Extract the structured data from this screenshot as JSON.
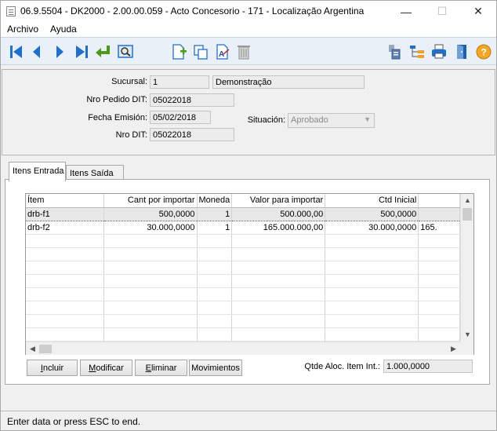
{
  "window": {
    "title": "06.9.5504 - DK2000 - 2.00.00.059 - Acto Concesorio - 171 - Localização Argentina",
    "minimize_glyph": "—",
    "maximize_glyph": "☐",
    "close_glyph": "✕"
  },
  "menu": {
    "items": [
      "Archivo",
      "Ayuda"
    ]
  },
  "toolbar": {
    "left_icons": [
      "first-record-icon",
      "prev-record-icon",
      "next-record-icon",
      "last-record-icon",
      "enter-icon",
      "search-icon"
    ],
    "mid_icons": [
      "new-document-icon",
      "copy-icon",
      "spell-check-icon",
      "trash-icon"
    ],
    "right_icons": [
      "report-icon",
      "hierarchy-icon",
      "printer-icon",
      "exit-icon",
      "help-icon"
    ],
    "help_glyph": "?"
  },
  "header": {
    "sucursal_label": "Sucursal:",
    "sucursal_code": "1",
    "sucursal_name": "Demonstração",
    "pedido_label": "Nro Pedido DIT:",
    "pedido_value": "05022018",
    "fecha_label": "Fecha Emisión:",
    "fecha_value": "05/02/2018",
    "situacion_label": "Situación:",
    "situacion_value": "Aprobado",
    "dit_label": "Nro DIT:",
    "dit_value": "05022018"
  },
  "tabs": [
    "Itens Entrada",
    "Itens Saída"
  ],
  "grid": {
    "columns": [
      "Ítem",
      "Cant por importar",
      "Moneda",
      "Valor para importar",
      "Ctd Inicial",
      ""
    ],
    "rows": [
      [
        "drb-f1",
        "500,0000",
        "1",
        "500.000,00",
        "500,0000",
        ""
      ],
      [
        "drb-f2",
        "30.000,0000",
        "1",
        "165.000.000,00",
        "30.000,0000",
        "165."
      ]
    ],
    "scroll_up": "▲",
    "scroll_down": "▼",
    "scroll_left": "◀",
    "scroll_right": "▶"
  },
  "buttons": {
    "incluir_hot": "I",
    "incluir_rest": "ncluir",
    "modificar_hot": "M",
    "modificar_rest": "odificar",
    "eliminar_hot": "E",
    "eliminar_rest": "liminar",
    "movimientos": "Movimientos"
  },
  "qtde": {
    "label": "Qtde Aloc. Item Int.:",
    "value": "1.000,0000"
  },
  "status": {
    "text": "Enter data or press ESC to end."
  },
  "colors": {
    "accent_blue": "#1f6fd0",
    "enter_green": "#4a9a1c",
    "help_orange": "#f5a623"
  }
}
